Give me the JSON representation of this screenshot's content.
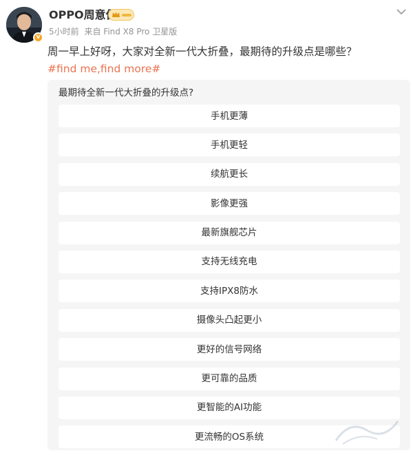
{
  "post": {
    "author": "OPPO周意保",
    "meta": {
      "time": "5小时前",
      "source": "来自 Find X8 Pro 卫星版"
    },
    "text": "周一早上好呀，大家对全新一代大折叠，最期待的升级点是哪些？",
    "hashtag": "#find me,find more#"
  },
  "icons": {
    "avatar": "avatar-photo",
    "verify": "verified-badge-icon",
    "vip": "crown-icon",
    "menu": "chevron-down-icon"
  },
  "colors": {
    "hashtag": "#eb7350",
    "vip": "#f0b840",
    "poll_bg": "#f5f5f5"
  },
  "poll": {
    "question": "最期待全新一代大折叠的升级点?",
    "options": [
      "手机更薄",
      "手机更轻",
      "续航更长",
      "影像更强",
      "最新旗舰芯片",
      "支持无线充电",
      "支持IPX8防水",
      "摄像头凸起更小",
      "更好的信号网络",
      "更可靠的品质",
      "更智能的AI功能",
      "更流畅的OS系统"
    ]
  }
}
